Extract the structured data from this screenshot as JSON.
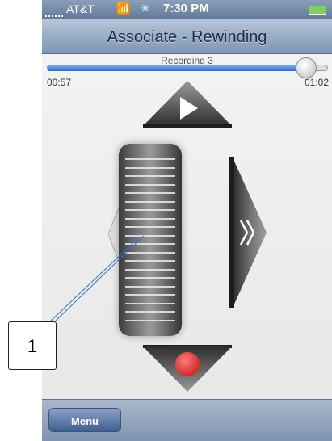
{
  "status_bar": {
    "carrier": "AT&T",
    "time": "7:30 PM",
    "wifi_icon": "wifi-icon",
    "activity_icon": "activity-spinner-icon",
    "battery_color": "#7bd35a"
  },
  "nav_bar": {
    "title": "Associate -  Rewinding"
  },
  "player": {
    "track_title": "Recording 3",
    "elapsed": "00:57",
    "total": "01:02",
    "progress_fraction": 0.92,
    "accent": "#2d6ed9",
    "record_color": "#e03030"
  },
  "controls": {
    "up_icon": "play-icon",
    "right_icon": "fast-forward-icon",
    "down_icon": "record-icon",
    "left_icon": "rewind-indicator-icon",
    "wheel_icon": "scroll-wheel"
  },
  "tab_bar": {
    "menu_label": "Menu"
  },
  "annotation": {
    "label": "1"
  }
}
